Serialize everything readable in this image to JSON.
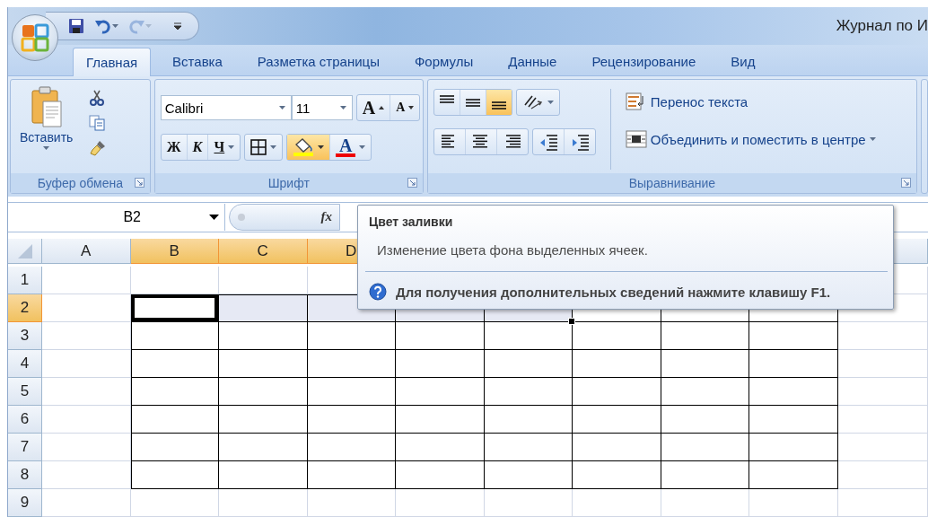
{
  "title_bar": {
    "document_title": "Журнал по И"
  },
  "quick_access": [
    {
      "kind": "save",
      "disabled": false
    },
    {
      "kind": "undo",
      "disabled": false
    },
    {
      "kind": "redo",
      "disabled": true
    },
    {
      "kind": "customize",
      "disabled": false
    }
  ],
  "tabs": [
    {
      "label": "Главная",
      "selected": true
    },
    {
      "label": "Вставка",
      "selected": false
    },
    {
      "label": "Разметка страницы",
      "selected": false
    },
    {
      "label": "Формулы",
      "selected": false
    },
    {
      "label": "Данные",
      "selected": false
    },
    {
      "label": "Рецензирование",
      "selected": false
    },
    {
      "label": "Вид",
      "selected": false
    }
  ],
  "clipboard": {
    "label": "Буфер обмена",
    "paste_label": "Вставить"
  },
  "font": {
    "label": "Шрифт",
    "font_name": "Calibri",
    "font_size": "11",
    "grow": "A",
    "shrink": "A",
    "bold": "Ж",
    "italic": "К",
    "underline": "Ч",
    "font_color": "A"
  },
  "alignment": {
    "label": "Выравнивание",
    "vertical": [
      {
        "kind": "top",
        "selected": false
      },
      {
        "kind": "middle",
        "selected": false
      },
      {
        "kind": "bottom",
        "selected": true
      }
    ],
    "horizontal": [
      {
        "kind": "left",
        "selected": false
      },
      {
        "kind": "center",
        "selected": false
      },
      {
        "kind": "right",
        "selected": false
      }
    ],
    "wrap_text": "Перенос текста",
    "merge": "Объединить и поместить в центре"
  },
  "formula_bar": {
    "name_box": "B2",
    "function_label": "fx"
  },
  "sheet": {
    "columns": [
      {
        "label": "A",
        "selected": false
      },
      {
        "label": "B",
        "selected": true
      },
      {
        "label": "C",
        "selected": true
      },
      {
        "label": "D",
        "selected": true
      }
    ],
    "rows": [
      {
        "label": "1",
        "selected": false,
        "cells": [
          {
            "bordered": false,
            "selected": false,
            "active": false
          },
          {
            "bordered": false,
            "selected": false,
            "active": false
          },
          {
            "bordered": false,
            "selected": false,
            "active": false
          },
          {
            "bordered": false,
            "selected": false,
            "active": false
          },
          null,
          null,
          null,
          null,
          null,
          {
            "bordered": false,
            "selected": false,
            "active": false
          }
        ]
      },
      {
        "label": "2",
        "selected": true,
        "cells": [
          {
            "bordered": false,
            "selected": false,
            "active": false
          },
          {
            "bordered": true,
            "selected": true,
            "active": true
          },
          {
            "bordered": true,
            "selected": true,
            "active": false
          },
          {
            "bordered": true,
            "selected": true,
            "active": false
          },
          {
            "bordered": true,
            "selected": true,
            "active": false
          },
          {
            "bordered": true,
            "selected": true,
            "active": false
          },
          {
            "bordered": true,
            "selected": false,
            "active": false
          },
          {
            "bordered": true,
            "selected": false,
            "active": false
          },
          {
            "bordered": true,
            "selected": false,
            "active": false
          },
          {
            "bordered": false,
            "selected": false,
            "active": false
          }
        ]
      },
      {
        "label": "3",
        "selected": false,
        "cells": [
          {
            "bordered": false,
            "selected": false,
            "active": false
          },
          {
            "bordered": true,
            "selected": false,
            "active": false
          },
          {
            "bordered": true,
            "selected": false,
            "active": false
          },
          {
            "bordered": true,
            "selected": false,
            "active": false
          },
          {
            "bordered": true,
            "selected": false,
            "active": false
          },
          {
            "bordered": true,
            "selected": false,
            "active": false
          },
          {
            "bordered": true,
            "selected": false,
            "active": false
          },
          {
            "bordered": true,
            "selected": false,
            "active": false
          },
          {
            "bordered": true,
            "selected": false,
            "active": false
          },
          {
            "bordered": false,
            "selected": false,
            "active": false
          }
        ]
      },
      {
        "label": "4",
        "selected": false,
        "cells": [
          {
            "bordered": false,
            "selected": false,
            "active": false
          },
          {
            "bordered": true,
            "selected": false,
            "active": false
          },
          {
            "bordered": true,
            "selected": false,
            "active": false
          },
          {
            "bordered": true,
            "selected": false,
            "active": false
          },
          {
            "bordered": true,
            "selected": false,
            "active": false
          },
          {
            "bordered": true,
            "selected": false,
            "active": false
          },
          {
            "bordered": true,
            "selected": false,
            "active": false
          },
          {
            "bordered": true,
            "selected": false,
            "active": false
          },
          {
            "bordered": true,
            "selected": false,
            "active": false
          },
          {
            "bordered": false,
            "selected": false,
            "active": false
          }
        ]
      },
      {
        "label": "5",
        "selected": false,
        "cells": [
          {
            "bordered": false,
            "selected": false,
            "active": false
          },
          {
            "bordered": true,
            "selected": false,
            "active": false
          },
          {
            "bordered": true,
            "selected": false,
            "active": false
          },
          {
            "bordered": true,
            "selected": false,
            "active": false
          },
          {
            "bordered": true,
            "selected": false,
            "active": false
          },
          {
            "bordered": true,
            "selected": false,
            "active": false
          },
          {
            "bordered": true,
            "selected": false,
            "active": false
          },
          {
            "bordered": true,
            "selected": false,
            "active": false
          },
          {
            "bordered": true,
            "selected": false,
            "active": false
          },
          {
            "bordered": false,
            "selected": false,
            "active": false
          }
        ]
      },
      {
        "label": "6",
        "selected": false,
        "cells": [
          {
            "bordered": false,
            "selected": false,
            "active": false
          },
          {
            "bordered": true,
            "selected": false,
            "active": false
          },
          {
            "bordered": true,
            "selected": false,
            "active": false
          },
          {
            "bordered": true,
            "selected": false,
            "active": false
          },
          {
            "bordered": true,
            "selected": false,
            "active": false
          },
          {
            "bordered": true,
            "selected": false,
            "active": false
          },
          {
            "bordered": true,
            "selected": false,
            "active": false
          },
          {
            "bordered": true,
            "selected": false,
            "active": false
          },
          {
            "bordered": true,
            "selected": false,
            "active": false
          },
          {
            "bordered": false,
            "selected": false,
            "active": false
          }
        ]
      },
      {
        "label": "7",
        "selected": false,
        "cells": [
          {
            "bordered": false,
            "selected": false,
            "active": false
          },
          {
            "bordered": true,
            "selected": false,
            "active": false
          },
          {
            "bordered": true,
            "selected": false,
            "active": false
          },
          {
            "bordered": true,
            "selected": false,
            "active": false
          },
          {
            "bordered": true,
            "selected": false,
            "active": false
          },
          {
            "bordered": true,
            "selected": false,
            "active": false
          },
          {
            "bordered": true,
            "selected": false,
            "active": false
          },
          {
            "bordered": true,
            "selected": false,
            "active": false
          },
          {
            "bordered": true,
            "selected": false,
            "active": false
          },
          {
            "bordered": false,
            "selected": false,
            "active": false
          }
        ]
      },
      {
        "label": "8",
        "selected": false,
        "cells": [
          {
            "bordered": false,
            "selected": false,
            "active": false
          },
          {
            "bordered": true,
            "selected": false,
            "active": false
          },
          {
            "bordered": true,
            "selected": false,
            "active": false
          },
          {
            "bordered": true,
            "selected": false,
            "active": false
          },
          {
            "bordered": true,
            "selected": false,
            "active": false
          },
          {
            "bordered": true,
            "selected": false,
            "active": false
          },
          {
            "bordered": true,
            "selected": false,
            "active": false
          },
          {
            "bordered": true,
            "selected": false,
            "active": false
          },
          {
            "bordered": true,
            "selected": false,
            "active": false
          },
          {
            "bordered": false,
            "selected": false,
            "active": false
          }
        ]
      },
      {
        "label": "9",
        "selected": false,
        "cells": [
          {
            "bordered": false,
            "selected": false,
            "active": false
          },
          {
            "bordered": false,
            "selected": false,
            "active": false
          },
          {
            "bordered": false,
            "selected": false,
            "active": false
          },
          {
            "bordered": false,
            "selected": false,
            "active": false
          },
          {
            "bordered": false,
            "selected": false,
            "active": false
          },
          {
            "bordered": false,
            "selected": false,
            "active": false
          },
          {
            "bordered": false,
            "selected": false,
            "active": false
          },
          {
            "bordered": false,
            "selected": false,
            "active": false
          },
          {
            "bordered": false,
            "selected": false,
            "active": false
          },
          {
            "bordered": false,
            "selected": false,
            "active": false
          }
        ]
      }
    ]
  },
  "tooltip": {
    "title": "Цвет заливки",
    "description": "Изменение цвета фона выделенных ячеек.",
    "help": "Для получения дополнительных сведений нажмите клавишу F1."
  }
}
